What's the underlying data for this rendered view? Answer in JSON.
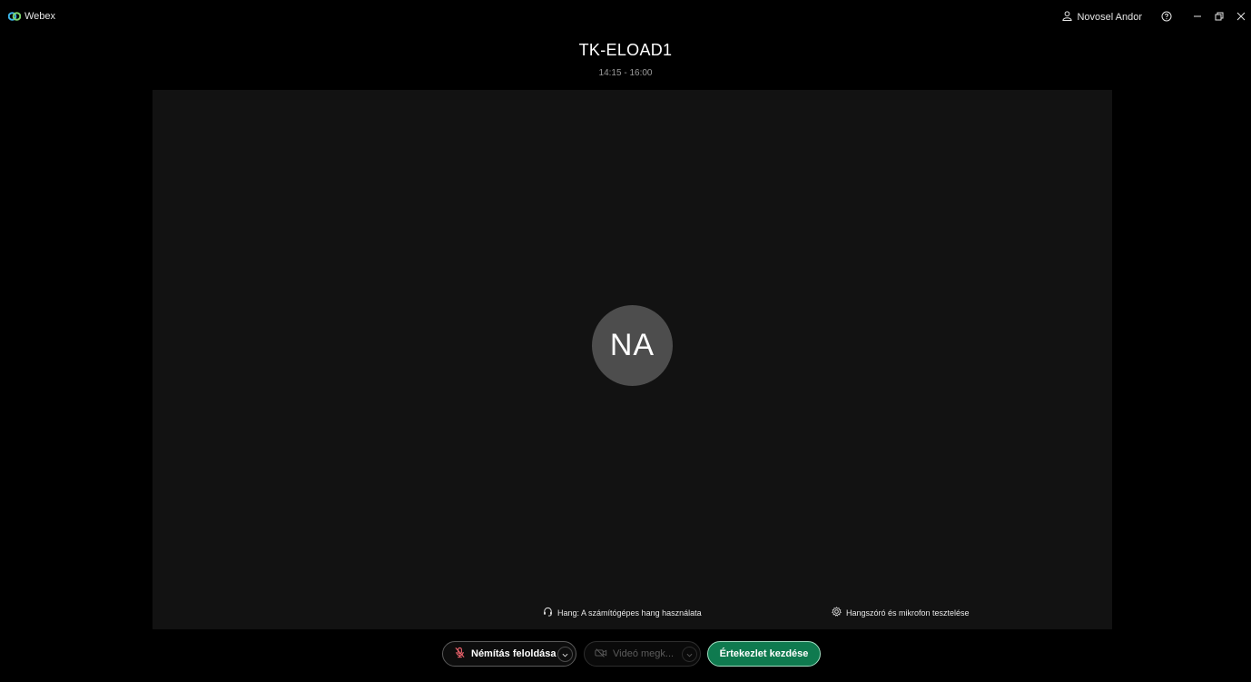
{
  "app": {
    "name": "Webex",
    "logo_icon": "webex-logo-icon"
  },
  "titlebar": {
    "user_name": "Novosel Andor",
    "user_icon": "user-icon",
    "help_icon": "help-icon",
    "minimize_icon": "minimize-icon",
    "restore_icon": "restore-icon",
    "close_icon": "close-icon"
  },
  "meeting": {
    "title": "TK-ELOAD1",
    "time": "14:15 - 16:00"
  },
  "preview": {
    "avatar_initials": "NA",
    "audio_label": "Hang: A számítógépes hang használata",
    "audio_icon": "headset-icon",
    "test_label": "Hangszóró és mikrofon tesztelése",
    "test_icon": "gear-icon"
  },
  "controls": {
    "unmute_label": "Némítás feloldása",
    "unmute_icon": "microphone-muted-icon",
    "video_label": "Videó megk...",
    "video_icon": "video-off-icon",
    "start_label": "Értekezlet kezdése"
  },
  "colors": {
    "background": "#000000",
    "stage": "#121212",
    "avatar": "#4d4d4d",
    "start_button": "#0f7a4f",
    "start_button_border": "#9fdcc0",
    "muted_icon": "#f0646e"
  }
}
